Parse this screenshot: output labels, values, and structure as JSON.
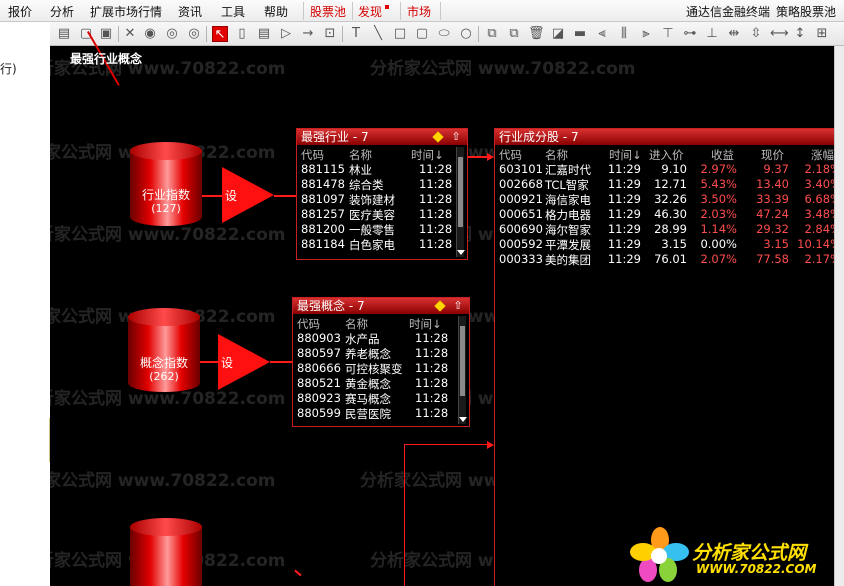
{
  "menu": {
    "items": [
      "报价",
      "分析",
      "扩展市场行情",
      "资讯",
      "工具",
      "帮助"
    ],
    "red_items": [
      "股票池",
      "发现",
      "市场"
    ],
    "right_items": [
      "通达信金融终端",
      "策略股票池"
    ]
  },
  "left_fragment": "行)",
  "annotation": "最强行业概念",
  "cylinders": [
    {
      "label": "行业指数",
      "count": "(127)"
    },
    {
      "label": "概念指数",
      "count": "(262)"
    },
    {
      "label": "",
      "count": ""
    }
  ],
  "set_label": "设",
  "panel_industry": {
    "title": "最强行业 - 7",
    "headers": [
      "代码",
      "名称",
      "时间↓"
    ],
    "rows": [
      [
        "881115",
        "林业",
        "11:28"
      ],
      [
        "881478",
        "综合类",
        "11:28"
      ],
      [
        "881097",
        "装饰建材",
        "11:28"
      ],
      [
        "881257",
        "医疗美容",
        "11:28"
      ],
      [
        "881200",
        "一般零售",
        "11:28"
      ],
      [
        "881184",
        "白色家电",
        "11:28"
      ]
    ]
  },
  "panel_concept": {
    "title": "最强概念 - 7",
    "headers": [
      "代码",
      "名称",
      "时间↓"
    ],
    "rows": [
      [
        "880903",
        "水产品",
        "11:28"
      ],
      [
        "880597",
        "养老概念",
        "11:28"
      ],
      [
        "880666",
        "可控核聚变",
        "11:28"
      ],
      [
        "880521",
        "黄金概念",
        "11:28"
      ],
      [
        "880923",
        "赛马概念",
        "11:28"
      ],
      [
        "880599",
        "民营医院",
        "11:28"
      ]
    ]
  },
  "panel_stocks": {
    "title": "行业成分股 - 7",
    "headers": [
      "代码",
      "名称",
      "时间↓",
      "进入价",
      "收益",
      "现价",
      "涨幅"
    ],
    "rows": [
      [
        "603101",
        "汇嘉时代",
        "11:29",
        "9.10",
        "2.97%",
        "9.37",
        "2.18%"
      ],
      [
        "002668",
        "TCL智家",
        "11:29",
        "12.71",
        "5.43%",
        "13.40",
        "3.40%"
      ],
      [
        "000921",
        "海信家电",
        "11:29",
        "32.26",
        "3.50%",
        "33.39",
        "6.68%"
      ],
      [
        "000651",
        "格力电器",
        "11:29",
        "46.30",
        "2.03%",
        "47.24",
        "3.48%"
      ],
      [
        "600690",
        "海尔智家",
        "11:29",
        "28.99",
        "1.14%",
        "29.32",
        "2.84%"
      ],
      [
        "000592",
        "平潭发展",
        "11:29",
        "3.15",
        "0.00%",
        "3.15",
        "10.14%"
      ],
      [
        "000333",
        "美的集团",
        "11:29",
        "76.01",
        "2.07%",
        "77.58",
        "2.17%"
      ]
    ]
  },
  "watermark": "分析家公式网 www.70822.com",
  "logo": {
    "name": "分析家公式网",
    "url": "WWW.70822.COM"
  },
  "colors": {
    "accent": "#e00000",
    "gain": "#ff4d4d",
    "background": "#000000"
  }
}
